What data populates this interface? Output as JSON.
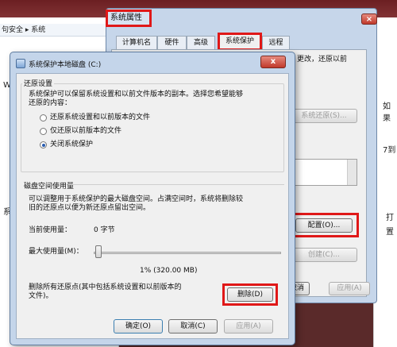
{
  "background": {
    "address_bar": "句安全 ▸ 系统",
    "left_fragment": "W",
    "left_fragment_2": "系",
    "right_fragments": [
      "如果",
      "7到",
      "打",
      "置"
    ]
  },
  "system_properties": {
    "title": "系统属性",
    "tabs": [
      "计算机名",
      "硬件",
      "高级",
      "系统保护",
      "远程"
    ],
    "desc": "更改，还原以前",
    "restore_button": "系统还原(S)...",
    "configure_button": "配置(O)...",
    "create_button": "创建(C)...",
    "ok_fragment": "定",
    "cancel_button": "取消",
    "apply_button": "应用(A)"
  },
  "protection_dialog": {
    "title": "系统保护本地磁盘 (C:)",
    "close_label": "x",
    "restore_settings": {
      "heading": "还原设置",
      "desc_line1": "系统保护可以保留系统设置和以前文件版本的副本。选择您希望能够",
      "desc_line2": "还原的内容：",
      "options": [
        "还原系统设置和以前版本的文件",
        "仅还原以前版本的文件",
        "关闭系统保护"
      ],
      "selected_index": 2
    },
    "disk_space": {
      "heading": "磁盘空间使用量",
      "desc_line1": "可以调整用于系统保护的最大磁盘空间。占满空间时，系统将删除较",
      "desc_line2": "旧的还原点以便为新还原点留出空间。",
      "current_label": "当前使用量：",
      "current_value": "0 字节",
      "max_label": "最大使用量(M)：",
      "slider_value_text": "1%  (320.00 MB)",
      "slider_fraction": 0.01
    },
    "delete_desc_line1": "删除所有还原点(其中包括系统设置和以前版本的",
    "delete_desc_line2": "文件)。",
    "delete_button": "删除(D)",
    "ok_button": "确定(O)",
    "cancel_button": "取消(C)",
    "apply_button": "应用(A)"
  }
}
